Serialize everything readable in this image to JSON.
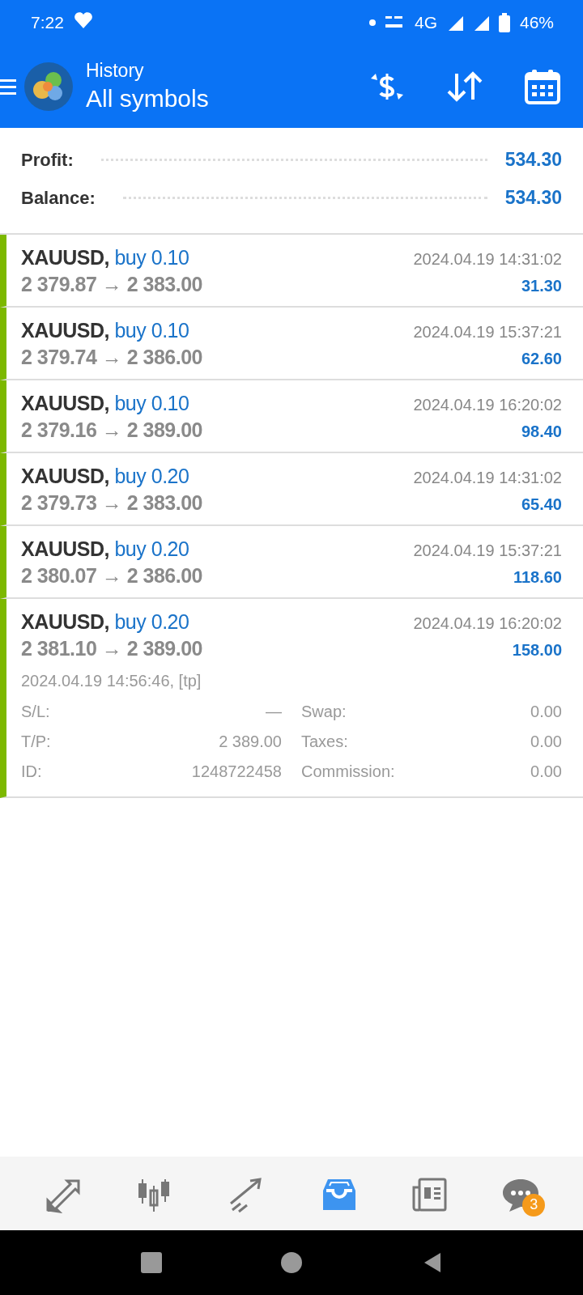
{
  "status_bar": {
    "time": "7:22",
    "network": "4G",
    "battery": "46%"
  },
  "header": {
    "title": "History",
    "subtitle": "All symbols"
  },
  "summary": [
    {
      "label": "Profit:",
      "value": "534.30"
    },
    {
      "label": "Balance:",
      "value": "534.30"
    }
  ],
  "deals": [
    {
      "symbol": "XAUUSD,",
      "side": "buy 0.10",
      "prices": "2 379.87 → 2 383.00",
      "time": "2024.04.19 14:31:02",
      "profit": "31.30"
    },
    {
      "symbol": "XAUUSD,",
      "side": "buy 0.10",
      "prices": "2 379.74 → 2 386.00",
      "time": "2024.04.19 15:37:21",
      "profit": "62.60"
    },
    {
      "symbol": "XAUUSD,",
      "side": "buy 0.10",
      "prices": "2 379.16 → 2 389.00",
      "time": "2024.04.19 16:20:02",
      "profit": "98.40"
    },
    {
      "symbol": "XAUUSD,",
      "side": "buy 0.20",
      "prices": "2 379.73 → 2 383.00",
      "time": "2024.04.19 14:31:02",
      "profit": "65.40"
    },
    {
      "symbol": "XAUUSD,",
      "side": "buy 0.20",
      "prices": "2 380.07 → 2 386.00",
      "time": "2024.04.19 15:37:21",
      "profit": "118.60"
    },
    {
      "symbol": "XAUUSD,",
      "side": "buy 0.20",
      "prices": "2 381.10 → 2 389.00",
      "time": "2024.04.19 16:20:02",
      "profit": "158.00",
      "details": {
        "open_info": "2024.04.19 14:56:46, [tp]",
        "fields": [
          {
            "label": "S/L:",
            "value": "—"
          },
          {
            "label": "Swap:",
            "value": "0.00"
          },
          {
            "label": "T/P:",
            "value": "2 389.00"
          },
          {
            "label": "Taxes:",
            "value": "0.00"
          },
          {
            "label": "ID:",
            "value": "1248722458"
          },
          {
            "label": "Commission:",
            "value": "0.00"
          }
        ]
      }
    }
  ],
  "bottom_nav": [
    {
      "kind": "trade",
      "selected": false
    },
    {
      "kind": "quotes",
      "selected": false
    },
    {
      "kind": "chart",
      "selected": false
    },
    {
      "kind": "history",
      "selected": true
    },
    {
      "kind": "news",
      "selected": false
    },
    {
      "kind": "chat",
      "selected": false,
      "badge": "3"
    }
  ]
}
